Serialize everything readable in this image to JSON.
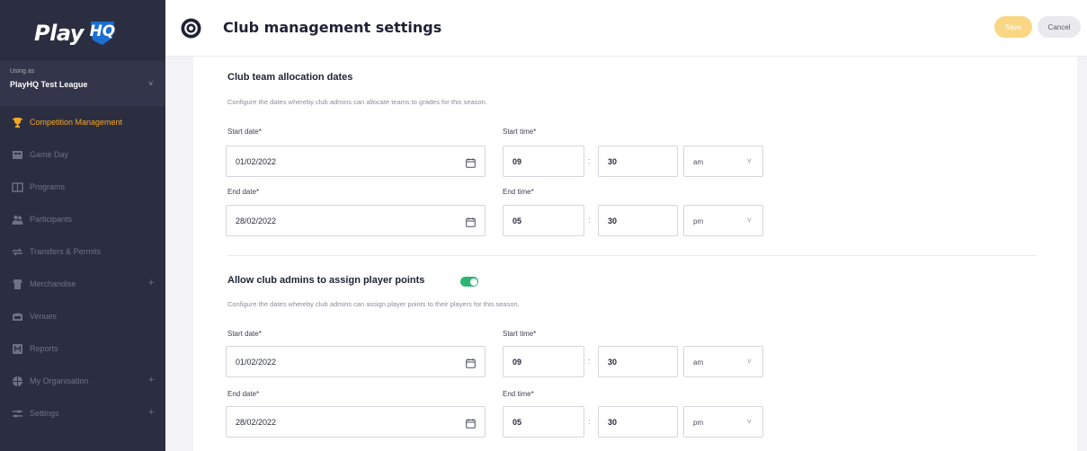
{
  "sidebar": {
    "logo_text": "Play",
    "logo_badge": "HQ",
    "org_caption": "Using as",
    "org_name": "PlayHQ Test League",
    "items": [
      {
        "label": "Competition Management",
        "icon": "trophy-icon",
        "active": true
      },
      {
        "label": "Game Day",
        "icon": "game-day-icon"
      },
      {
        "label": "Programs",
        "icon": "book-icon"
      },
      {
        "label": "Participants",
        "icon": "people-icon"
      },
      {
        "label": "Transfers & Permits",
        "icon": "transfer-icon"
      },
      {
        "label": "Merchandise",
        "icon": "merchandise-icon",
        "expandable": true
      },
      {
        "label": "Venues",
        "icon": "venue-icon"
      },
      {
        "label": "Reports",
        "icon": "reports-icon"
      },
      {
        "label": "My Organisation",
        "icon": "organisation-icon",
        "expandable": true
      },
      {
        "label": "Settings",
        "icon": "settings-icon",
        "expandable": true
      }
    ],
    "expand_symbol": "+",
    "collapse_symbol": "˅"
  },
  "header": {
    "title": "Club management settings",
    "save_label": "Save",
    "cancel_label": "Cancel"
  },
  "sections": {
    "allocation": {
      "title": "Club team allocation dates",
      "description": "Configure the dates whereby club admins can allocate teams to grades for this season.",
      "start_date_label": "Start date*",
      "start_date": "01/02/2022",
      "start_time_label": "Start time*",
      "start_hour": "09",
      "start_minute": "30",
      "start_ampm": "am",
      "end_date_label": "End date*",
      "end_date": "28/02/2022",
      "end_time_label": "End time*",
      "end_hour": "05",
      "end_minute": "30",
      "end_ampm": "pm"
    },
    "points": {
      "title": "Allow club admins to assign player points",
      "toggle_on": true,
      "description": "Configure the dates whereby club admins can assign player points to their players for this season.",
      "start_date_label": "Start date*",
      "start_date": "01/02/2022",
      "start_time_label": "Start time*",
      "start_hour": "09",
      "start_minute": "30",
      "start_ampm": "am",
      "end_date_label": "End date*",
      "end_date": "28/02/2022",
      "end_time_label": "End time*",
      "end_hour": "05",
      "end_minute": "30",
      "end_ampm": "pm"
    }
  },
  "colon": ":",
  "select_chevron": "˅",
  "colors": {
    "sidebar_bg": "#2b2e40",
    "accent": "#f5a524",
    "toggle_on": "#2bb673",
    "save_bg": "#f9d785"
  }
}
